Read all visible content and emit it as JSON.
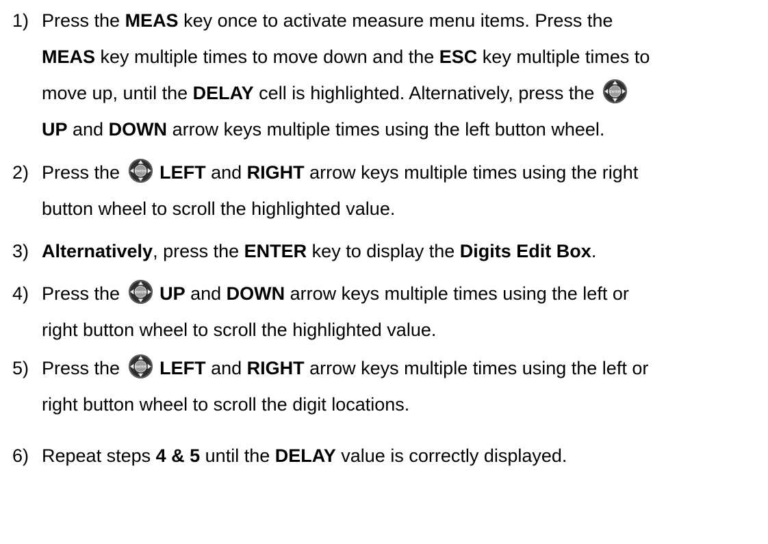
{
  "steps": [
    {
      "num": "1)",
      "parts": [
        {
          "t": "Press the "
        },
        {
          "t": "MEAS",
          "b": true
        },
        {
          "t": " key once to activate measure menu items.  Press the "
        },
        {
          "br": true
        },
        {
          "t": "MEAS",
          "b": true
        },
        {
          "t": " key multiple times to move down and the "
        },
        {
          "t": "ESC",
          "b": true
        },
        {
          "t": " key multiple times to "
        },
        {
          "br": true
        },
        {
          "t": "move up, until the "
        },
        {
          "t": "DELAY",
          "b": true
        },
        {
          "t": " cell is highlighted.  Alternatively, press the "
        },
        {
          "icon": "arrow-pad-icon"
        },
        {
          "br": true
        },
        {
          "t": "UP",
          "b": true
        },
        {
          "t": " and "
        },
        {
          "t": "DOWN",
          "b": true
        },
        {
          "t": " arrow keys multiple times using the left button wheel."
        }
      ]
    },
    {
      "num": "2)",
      "parts": [
        {
          "t": "Press the "
        },
        {
          "icon": "arrow-pad-icon"
        },
        {
          "t": " "
        },
        {
          "t": "LEFT",
          "b": true
        },
        {
          "t": " and "
        },
        {
          "t": "RIGHT",
          "b": true
        },
        {
          "t": " arrow keys multiple times using the right "
        },
        {
          "br": true
        },
        {
          "t": "button wheel to scroll the highlighted value."
        }
      ]
    },
    {
      "num": "3)",
      "parts": [
        {
          "t": "Alternatively",
          "b": true
        },
        {
          "t": ", press the "
        },
        {
          "t": "ENTER",
          "b": true
        },
        {
          "t": " key to display the "
        },
        {
          "t": "Digits Edit Box",
          "b": true
        },
        {
          "t": "."
        }
      ]
    },
    {
      "num": "4)",
      "parts": [
        {
          "t": "Press the "
        },
        {
          "icon": "arrow-pad-icon"
        },
        {
          "t": " "
        },
        {
          "t": "UP",
          "b": true
        },
        {
          "t": " and "
        },
        {
          "t": "DOWN",
          "b": true
        },
        {
          "t": " arrow keys multiple times using the left or "
        },
        {
          "br": true
        },
        {
          "t": "right button wheel to scroll the highlighted value."
        }
      ]
    },
    {
      "num": "5)",
      "parts": [
        {
          "t": "Press the "
        },
        {
          "icon": "arrow-pad-icon"
        },
        {
          "t": " "
        },
        {
          "t": "LEFT",
          "b": true
        },
        {
          "t": " and "
        },
        {
          "t": "RIGHT",
          "b": true
        },
        {
          "t": " arrow keys multiple times using the left or "
        },
        {
          "br": true
        },
        {
          "t": "right button wheel to scroll the digit locations."
        }
      ]
    },
    {
      "num": "6)",
      "parts": [
        {
          "t": "Repeat steps "
        },
        {
          "t": "4 & 5",
          "b": true
        },
        {
          "t": " until the "
        },
        {
          "t": "DELAY",
          "b": true
        },
        {
          "t": " value is correctly displayed."
        }
      ]
    }
  ],
  "icon_label": "ENTER",
  "colors": {
    "pad_outer": "#5a5a5a",
    "pad_inner": "#2e2e2e",
    "pad_center": "#9a9a9a",
    "arrow": "#f0f0f0"
  }
}
